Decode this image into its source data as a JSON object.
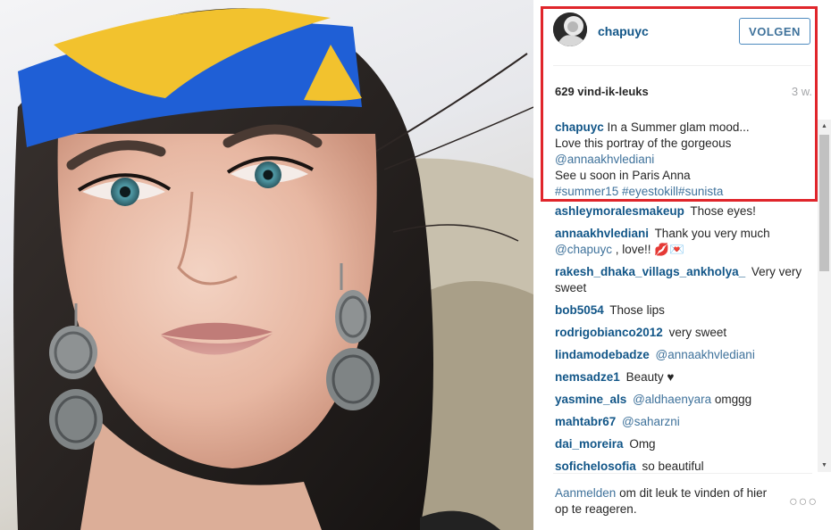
{
  "post": {
    "username": "chapuyc",
    "follow_label": "VOLGEN",
    "likes": "629 vind-ik-leuks",
    "age": "3 w.",
    "caption": {
      "username": "chapuyc",
      "line1": "In a Summer glam mood...",
      "line2": "Love this portray of the gorgeous",
      "mention": "@annaakhvlediani",
      "line3": "See u soon in Paris Anna",
      "hashtags": "#summer15 #eyestokill#sunista"
    }
  },
  "comments": [
    {
      "user": "ashleymoralesmakeup",
      "text": "Those eyes!"
    },
    {
      "user": "annaakhvlediani",
      "text": "Thank you very much",
      "mention": "@chapuyc",
      "text2": ", love!! 💋💌"
    },
    {
      "user": "rakesh_dhaka_villags_ankholya_",
      "text": "Very very sweet"
    },
    {
      "user": "bob5054",
      "text": "Those lips"
    },
    {
      "user": "rodrigobianco2012",
      "text": "very sweet"
    },
    {
      "user": "lindamodebadze",
      "mention": "@annaakhvlediani"
    },
    {
      "user": "nemsadze1",
      "text": "Beauty ♥"
    },
    {
      "user": "yasmine_als",
      "mention": "@aldhaenyara",
      "text2": "omggg"
    },
    {
      "user": "mahtabr67",
      "mention": "@saharzni"
    },
    {
      "user": "dai_moreira",
      "text": "Omg"
    },
    {
      "user": "sofichelosofia",
      "text": "so beautiful"
    }
  ],
  "footer": {
    "login_link": "Aanmelden",
    "text": "om dit leuk te vinden of hier op te reageren.",
    "more": "○○○"
  },
  "scrollbar": {
    "up": "▲",
    "down": "▼"
  },
  "colors": {
    "username_blue": "#125688",
    "link_blue": "#3f729b",
    "highlight_red": "#e0252b",
    "headband_blue": "#1f5fd6",
    "headband_yellow": "#f2c22e"
  }
}
